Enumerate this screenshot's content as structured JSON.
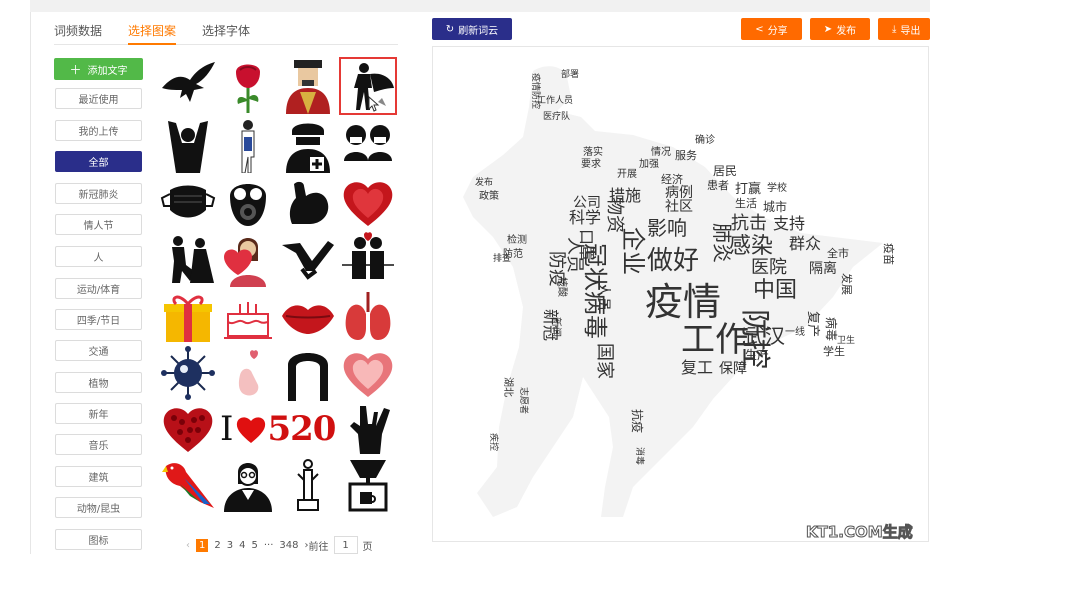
{
  "tabs": [
    "词频数据",
    "选择图案",
    "选择字体"
  ],
  "add_text_label": "添加文字",
  "categories": [
    "最近使用",
    "我的上传",
    "全部",
    "新冠肺炎",
    "情人节",
    "人",
    "运动/体育",
    "四季/节日",
    "交通",
    "植物",
    "新年",
    "音乐",
    "建筑",
    "动物/昆虫",
    "图标"
  ],
  "active_category": "全部",
  "gallery_icons": [
    "eagle-icon",
    "rose-icon",
    "emperor-icon",
    "superhero-icon",
    "cheering-man-icon",
    "doctor-icon",
    "nurse-icon",
    "masked-couple-icon",
    "face-mask-icon",
    "gas-mask-icon",
    "flexed-arm-icon",
    "red-heart-icon",
    "proposal-icon",
    "woman-heart-icon",
    "holding-hands-icon",
    "kissing-couple-icon",
    "gift-box-icon",
    "birthday-cake-icon",
    "lips-icon",
    "lungs-icon",
    "virus-icon",
    "finger-heart-icon",
    "hug-couple-icon",
    "pink-heart-icon",
    "rose-heart-icon",
    "i-love-520-icon",
    "rock-hand-icon",
    "parrot-icon",
    "jobs-portrait-icon",
    "oscar-statue-icon",
    "coffee-maker-icon"
  ],
  "i_love_520": {
    "i": "I",
    "num": "520"
  },
  "pagination": {
    "pages": [
      "1",
      "2",
      "3",
      "4",
      "5"
    ],
    "ellipsis": "···",
    "last": "348",
    "goto_prefix": "前往",
    "goto_value": "1",
    "goto_suffix": "页"
  },
  "toolbar": {
    "refresh_label": "刷新词云",
    "share_label": "分享",
    "publish_label": "发布",
    "export_label": "导出"
  },
  "watermark": "KT1.COM生成",
  "words": [
    "疫情",
    "工作",
    "防控",
    "做好",
    "冠状病毒",
    "企业",
    "感染",
    "医院",
    "中国",
    "武汉",
    "肺炎",
    "防疫",
    "影响",
    "物资",
    "科学",
    "措施",
    "公司",
    "人员",
    "抗击",
    "支持",
    "群众",
    "隔离",
    "复工",
    "保障",
    "国家",
    "新冠",
    "社区",
    "病例",
    "居民",
    "生产",
    "城市",
    "打赢",
    "生活",
    "复产",
    "患者",
    "学生",
    "病毒",
    "口罩",
    "人员",
    "全市",
    "发展",
    "医疗队",
    "工作人员",
    "部署",
    "疫苗",
    "检测",
    "抗疫",
    "防范",
    "疫情防控",
    "发布",
    "新闻",
    "服务",
    "要求",
    "开展",
    "加强",
    "落实",
    "情况",
    "确诊",
    "核酸",
    "一线",
    "湖北",
    "政策",
    "疾控",
    "经济",
    "学校",
    "消毒",
    "排查",
    "志愿者",
    "卫生"
  ],
  "colors": {
    "orange": "#ff6a00",
    "navy": "#2a2e8a",
    "green": "#52b948",
    "red_selected": "#e53935"
  }
}
